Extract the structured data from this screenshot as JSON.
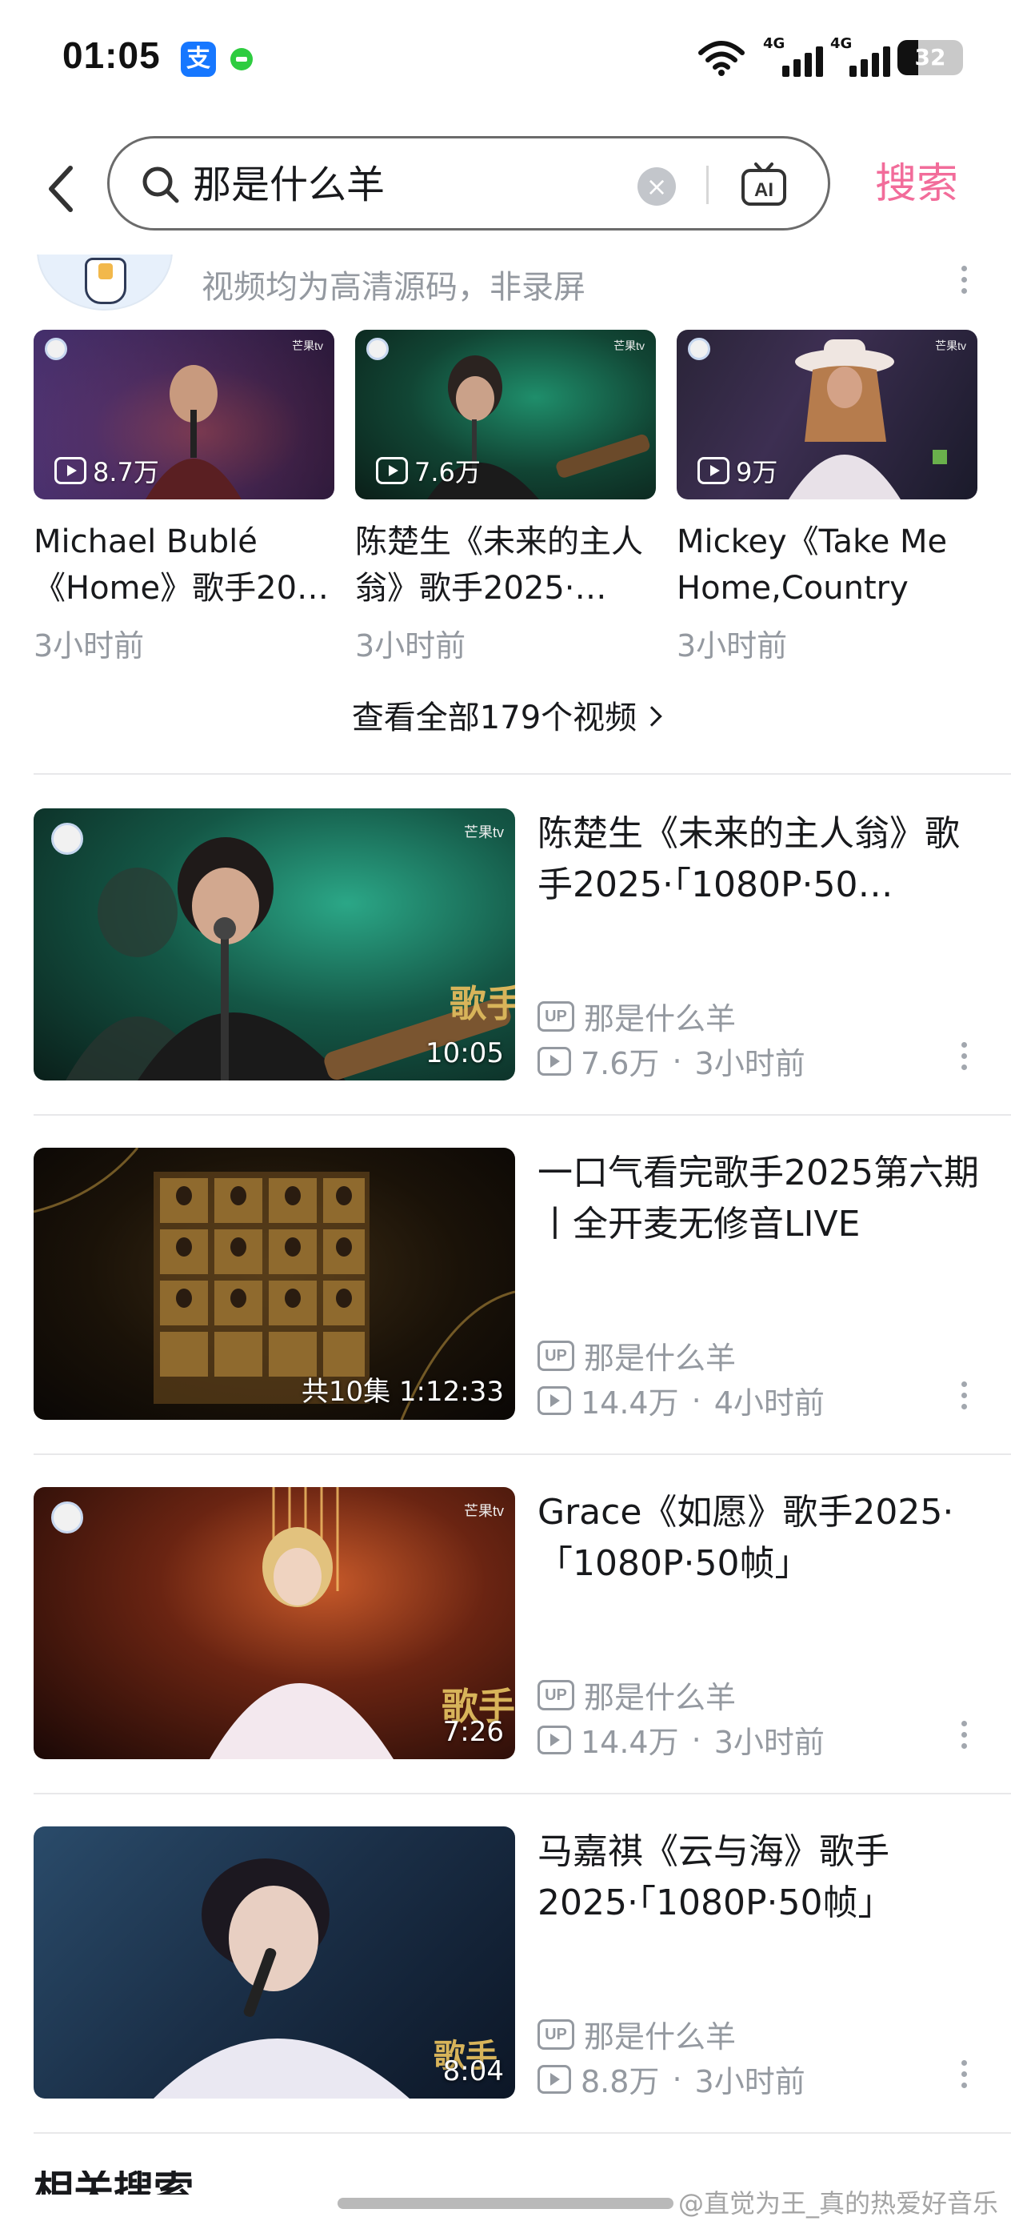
{
  "status_bar": {
    "time": "01:05",
    "app1_glyph": "支",
    "signal1_label": "4G",
    "signal2_label": "4G",
    "battery": "32",
    "battery_level": 0.32
  },
  "search": {
    "query": "那是什么羊",
    "button": "搜索",
    "clear_glyph": "×"
  },
  "uploader_card": {
    "description": "视频均为高清源码，非录屏",
    "videos": [
      {
        "title": "Michael Bublé《Home》歌手20…",
        "views": "8.7万",
        "time": "3小时前"
      },
      {
        "title": "陈楚生《未来的主人翁》歌手2025·…",
        "views": "7.6万",
        "time": "3小时前"
      },
      {
        "title": "Mickey《Take Me Home,Country Ro…",
        "views": "9万",
        "time": "3小时前"
      }
    ],
    "view_all": "查看全部179个视频"
  },
  "results": [
    {
      "title": "陈楚生《未来的主人翁》歌手2025·「1080P·50…",
      "duration": "10:05",
      "uploader": "那是什么羊",
      "views": "7.6万",
      "time": "3小时前"
    },
    {
      "title": "一口气看完歌手2025第六期丨全开麦无修音LIVE",
      "duration": "共10集 1:12:33",
      "uploader": "那是什么羊",
      "views": "14.4万",
      "time": "4小时前"
    },
    {
      "title": "Grace《如愿》歌手2025·「1080P·50帧」",
      "duration": "7:26",
      "uploader": "那是什么羊",
      "views": "14.4万",
      "time": "3小时前"
    },
    {
      "title": "马嘉祺《云与海》歌手2025·「1080P·50帧」",
      "duration": "8:04",
      "uploader": "那是什么羊",
      "views": "8.8万",
      "time": "3小时前"
    }
  ],
  "labels": {
    "up_badge": "UP",
    "dot_separator": "·",
    "thumb_brand": "芒果tv",
    "partial_heading": "相关搜索"
  },
  "watermark": "@直觉为王_真的热爱好音乐",
  "colors": {
    "accent": "#f26c9a",
    "secondary_text": "#9499a0"
  }
}
